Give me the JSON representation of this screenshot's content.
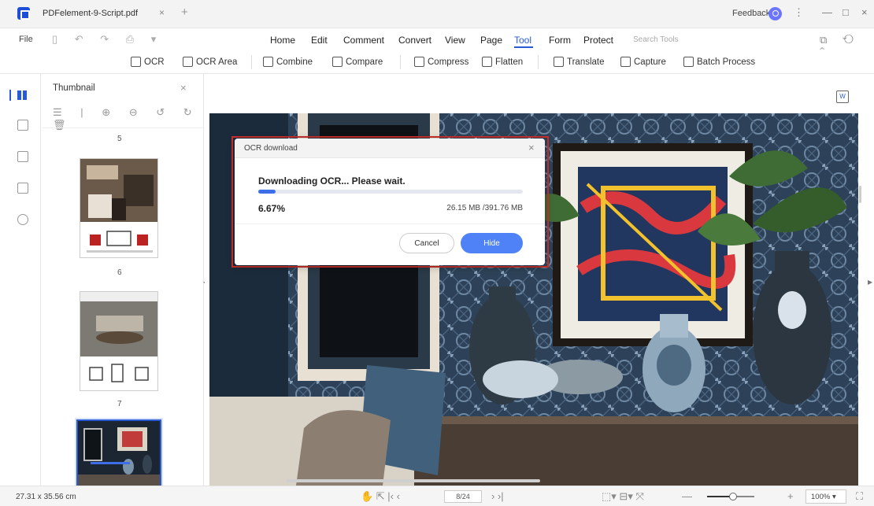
{
  "window": {
    "tab_title": "PDFelement-9-Script.pdf",
    "tab_close": "×",
    "new_tab": "+",
    "feedback": "Feedback",
    "controls": {
      "more": "⋮",
      "minimize": "—",
      "maximize": "□",
      "close": "×"
    }
  },
  "menubar": {
    "file": "File",
    "quick_icons": "▯ ↶ ↷ ⎙ ▾",
    "items": [
      "Home",
      "Edit",
      "Comment",
      "Convert",
      "View",
      "Page",
      "Tool",
      "Form",
      "Protect"
    ],
    "active": "Tool",
    "search_placeholder": "Search Tools",
    "right_icons": "⧉ ⟲ ⌃"
  },
  "toolbar": {
    "tools": [
      {
        "label": "OCR",
        "icon": "ocr-icon"
      },
      {
        "label": "OCR Area",
        "icon": "ocr-area-icon"
      },
      {
        "label": "Combine",
        "icon": "combine-icon"
      },
      {
        "label": "Compare",
        "icon": "compare-icon"
      },
      {
        "label": "Compress",
        "icon": "compress-icon"
      },
      {
        "label": "Flatten",
        "icon": "flatten-icon"
      },
      {
        "label": "Translate",
        "icon": "translate-icon"
      },
      {
        "label": "Capture",
        "icon": "capture-icon"
      },
      {
        "label": "Batch Process",
        "icon": "batch-process-icon"
      }
    ]
  },
  "left_rail": {
    "icons": [
      "thumbnail-icon",
      "bookmark-icon",
      "comment-icon",
      "attachment-icon",
      "search-icon"
    ],
    "active": "thumbnail-icon"
  },
  "thumbnail_panel": {
    "title": "Thumbnail",
    "close": "×",
    "tools": "☰ | ⊕ ⊖ ↺ ↻ 🗑",
    "pages": [
      "5",
      "6",
      "7"
    ],
    "selected_page": "7"
  },
  "dialog": {
    "title": "OCR download",
    "close": "×",
    "message": "Downloading OCR... Please wait.",
    "progress_percent": 6.67,
    "percent_label": "6.67%",
    "size_label": "26.15 MB /391.76 MB",
    "cancel": "Cancel",
    "hide": "Hide"
  },
  "statusbar": {
    "page_size": "27.31 x 35.56 cm",
    "page_indicator": "8/24",
    "zoom": "100%",
    "nav_icons": "✋ ⇱ |‹ ‹",
    "nav_icons_right": "› ›|",
    "view_icons": "⬚▾ ⊟▾ ⤧",
    "zoom_minus": "—",
    "zoom_plus": "+",
    "zoom_fraction": 0.55,
    "fullscreen": "⛶"
  },
  "colors": {
    "accent": "#2a5bd7",
    "hide_button": "#4f82f7",
    "progress": "#3d6ee8",
    "highlight_outline": "#c9302c"
  }
}
